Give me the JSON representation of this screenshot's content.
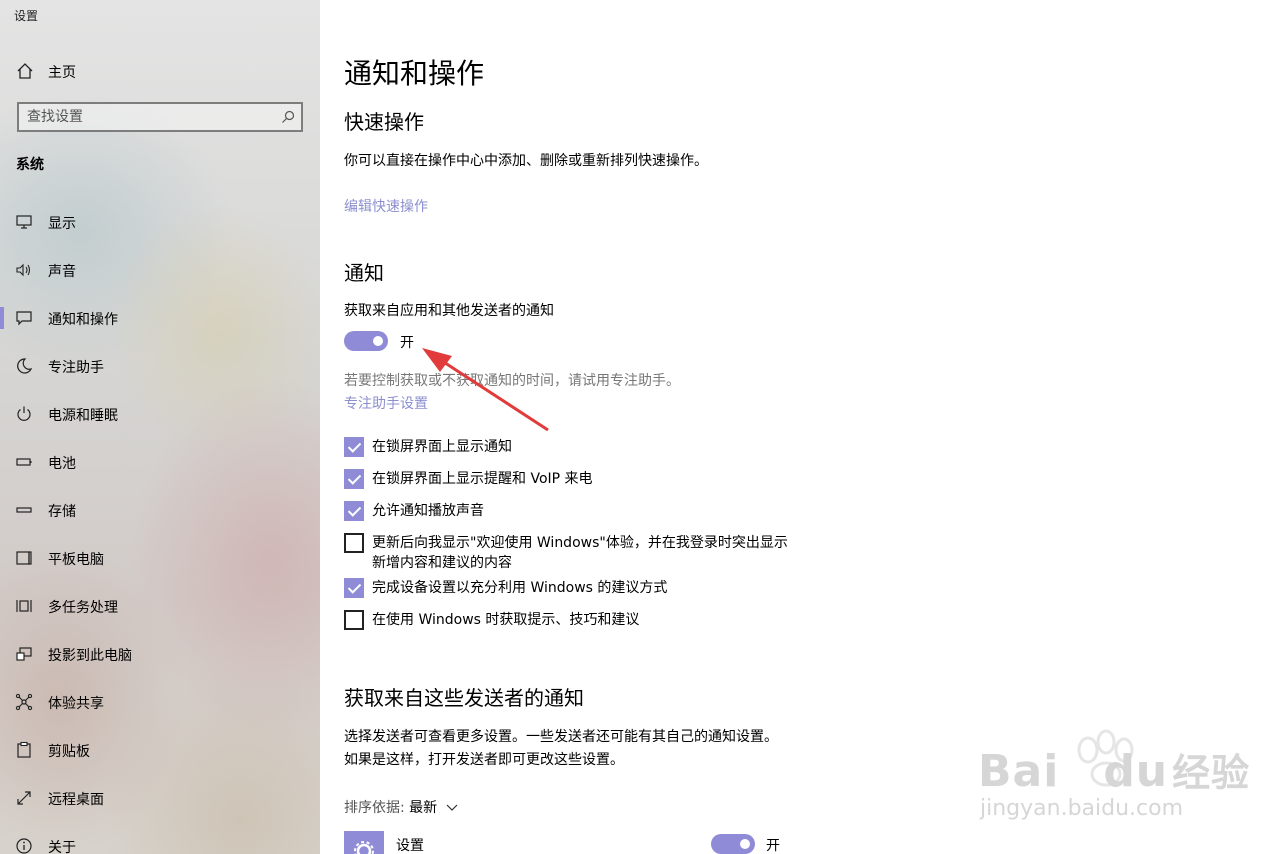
{
  "window": {
    "title": "设置"
  },
  "sidebar": {
    "home_label": "主页",
    "search_placeholder": "查找设置",
    "section": "系统",
    "items": [
      {
        "label": "显示",
        "icon": "monitor-icon"
      },
      {
        "label": "声音",
        "icon": "speaker-icon"
      },
      {
        "label": "通知和操作",
        "icon": "notification-icon",
        "active": true
      },
      {
        "label": "专注助手",
        "icon": "moon-icon"
      },
      {
        "label": "电源和睡眠",
        "icon": "power-icon"
      },
      {
        "label": "电池",
        "icon": "battery-icon"
      },
      {
        "label": "存储",
        "icon": "storage-icon"
      },
      {
        "label": "平板电脑",
        "icon": "tablet-icon"
      },
      {
        "label": "多任务处理",
        "icon": "multitask-icon"
      },
      {
        "label": "投影到此电脑",
        "icon": "project-icon"
      },
      {
        "label": "体验共享",
        "icon": "share-icon"
      },
      {
        "label": "剪贴板",
        "icon": "clipboard-icon"
      },
      {
        "label": "远程桌面",
        "icon": "remote-desktop-icon"
      },
      {
        "label": "关于",
        "icon": "info-icon"
      }
    ]
  },
  "main": {
    "title": "通知和操作",
    "quick_actions": {
      "heading": "快速操作",
      "description": "你可以直接在操作中心中添加、删除或重新排列快速操作。",
      "edit_link": "编辑快速操作"
    },
    "notifications": {
      "heading": "通知",
      "toggle_caption": "获取来自应用和其他发送者的通知",
      "toggle_state": "开",
      "focus_hint": "若要控制获取或不获取通知的时间，请试用专注助手。",
      "focus_link": "专注助手设置",
      "checkboxes": [
        {
          "label": "在锁屏界面上显示通知",
          "checked": true
        },
        {
          "label": "在锁屏界面上显示提醒和 VoIP 来电",
          "checked": true
        },
        {
          "label": "允许通知播放声音",
          "checked": true
        },
        {
          "label": "更新后向我显示\"欢迎使用 Windows\"体验，并在我登录时突出显示新增内容和建议的内容",
          "checked": false
        },
        {
          "label": "完成设备设置以充分利用 Windows 的建议方式",
          "checked": true
        },
        {
          "label": "在使用 Windows 时获取提示、技巧和建议",
          "checked": false
        }
      ]
    },
    "senders": {
      "heading": "获取来自这些发送者的通知",
      "description": "选择发送者可查看更多设置。一些发送者还可能有其自己的通知设置。如果是这样，打开发送者即可更改这些设置。",
      "sort_label": "排序依据:",
      "sort_value": "最新",
      "items": [
        {
          "name": "设置",
          "state": "开"
        }
      ]
    }
  },
  "watermark": {
    "brand": "Bai",
    "brand2": "du",
    "cn": "经验",
    "url": "jingyan.baidu.com"
  },
  "colors": {
    "accent": "#8f8bd6",
    "link": "#8c8fcf",
    "annotation": "#e23b3b"
  }
}
